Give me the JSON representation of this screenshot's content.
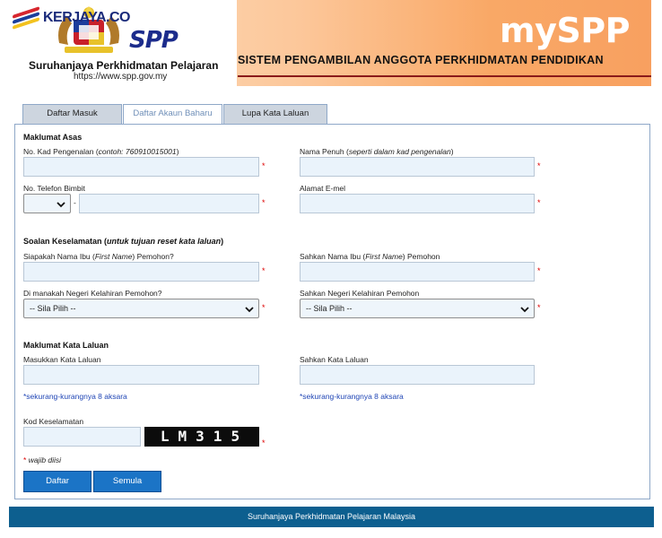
{
  "header": {
    "watermark": "KERJAYA.CO",
    "logo_text": "SPP",
    "agency_name": "Suruhanjaya Perkhidmatan Pelajaran",
    "agency_url": "https://www.spp.gov.my",
    "brand": "mySPP",
    "system_title": "SISTEM PENGAMBILAN ANGGOTA PERKHIDMATAN PENDIDIKAN"
  },
  "tabs": [
    {
      "label": "Daftar Masuk",
      "active": false
    },
    {
      "label": "Daftar Akaun Baharu",
      "active": true
    },
    {
      "label": "Lupa Kata Laluan",
      "active": false
    }
  ],
  "sections": {
    "basic": "Maklumat Asas",
    "security_title": "Soalan Keselamatan",
    "security_note": "untuk tujuan reset kata laluan",
    "password": "Maklumat Kata Laluan"
  },
  "fields": {
    "ic_label": "No. Kad Pengenalan",
    "ic_example": "contoh: 760910015001",
    "fullname_label": "Nama Penuh",
    "fullname_note": "seperti dalam kad pengenalan",
    "phone_label": "No. Telefon Bimbit",
    "phone_separator": "-",
    "email_label": "Alamat E-mel",
    "mother_label_a": "Siapakah Nama Ibu (",
    "mother_label_em": "First Name",
    "mother_label_b": ") Pemohon?",
    "mother_confirm_a": "Sahkan Nama Ibu (",
    "mother_confirm_em": "First Name",
    "mother_confirm_b": ") Pemohon",
    "state_label": "Di manakah Negeri Kelahiran Pemohon?",
    "state_confirm_label": "Sahkan Negeri Kelahiran Pemohon",
    "state_selected": "-- Sila Pilih --",
    "state_confirm_selected": "-- Sila Pilih --",
    "password_label": "Masukkan Kata Laluan",
    "password_confirm_label": "Sahkan Kata Laluan",
    "password_hint": "*sekurang-kurangnya 8 aksara",
    "password_confirm_hint": "*sekurang-kurangnya 8 aksara",
    "captcha_label": "Kod Keselamatan",
    "captcha_code": "LM315"
  },
  "required_mark": "*",
  "required_note": "wajib diisi",
  "buttons": {
    "register": "Daftar",
    "reset": "Semula"
  },
  "footer": "Suruhanjaya Perkhidmatan Pelajaran Malaysia",
  "colors": {
    "button": "#1b74c6",
    "footer": "#0d5f8f",
    "input_bg": "#eaf3fb",
    "required": "#dd0000",
    "hint": "#1f45b5"
  }
}
